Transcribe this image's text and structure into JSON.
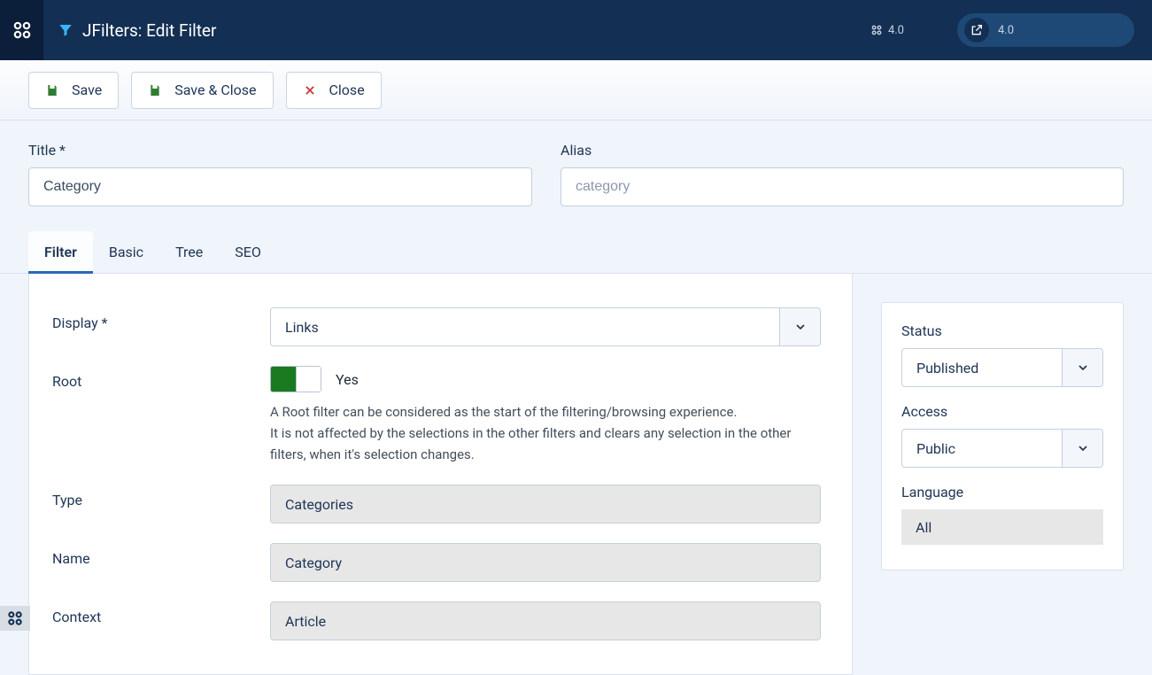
{
  "header": {
    "title": "JFilters: Edit Filter",
    "version_left": "4.0",
    "version_right": "4.0"
  },
  "toolbar": {
    "save": "Save",
    "save_close": "Save & Close",
    "close": "Close"
  },
  "fields": {
    "title_label": "Title *",
    "title_value": "Category",
    "alias_label": "Alias",
    "alias_value": "category"
  },
  "tabs": {
    "filter": "Filter",
    "basic": "Basic",
    "tree": "Tree",
    "seo": "SEO"
  },
  "form": {
    "display_label": "Display *",
    "display_value": "Links",
    "root_label": "Root",
    "root_toggle": "Yes",
    "root_help1": "A Root filter can be considered as the start of the filtering/browsing experience.",
    "root_help2": "It is not affected by the selections in the other filters and clears any selection in the other filters, when it's selection changes.",
    "type_label": "Type",
    "type_value": "Categories",
    "name_label": "Name",
    "name_value": "Category",
    "context_label": "Context",
    "context_value": "Article"
  },
  "sidebar": {
    "status_label": "Status",
    "status_value": "Published",
    "access_label": "Access",
    "access_value": "Public",
    "language_label": "Language",
    "language_value": "All"
  }
}
